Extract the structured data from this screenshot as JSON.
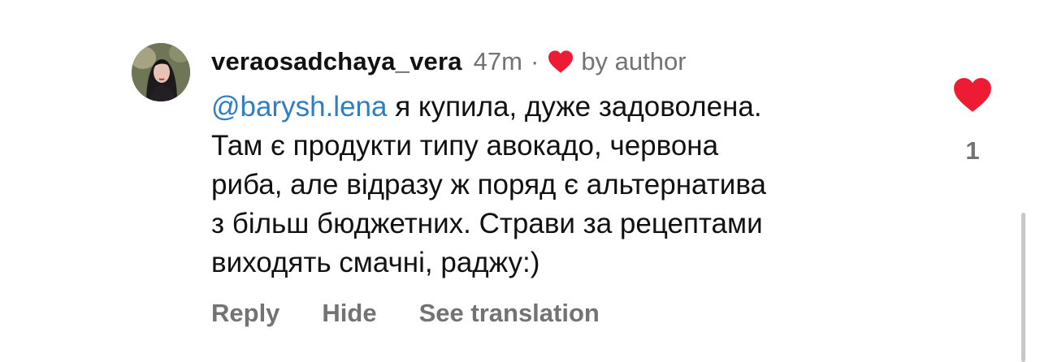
{
  "comment": {
    "username": "veraosadchaya_vera",
    "time": "47m",
    "separator": "·",
    "liked_by": "by author",
    "mention": "@barysh.lena",
    "text_lines": [
      " я купила, дуже задоволена.",
      "Там є продукти типу авокадо, червона",
      "риба, але відразу ж поряд є альтернатива",
      "з більш бюджетних. Страви за рецептами",
      "виходять смачні, раджу:)"
    ]
  },
  "actions": {
    "reply": "Reply",
    "hide": "Hide",
    "see_translation": "See translation"
  },
  "likes": {
    "count": "1",
    "liked": true
  },
  "colors": {
    "heart": "#ed1b33",
    "mention": "#2f7ec4",
    "muted": "#737373",
    "text": "#111111"
  },
  "icons": {
    "author_heart": "heart-icon",
    "like": "heart-icon"
  }
}
